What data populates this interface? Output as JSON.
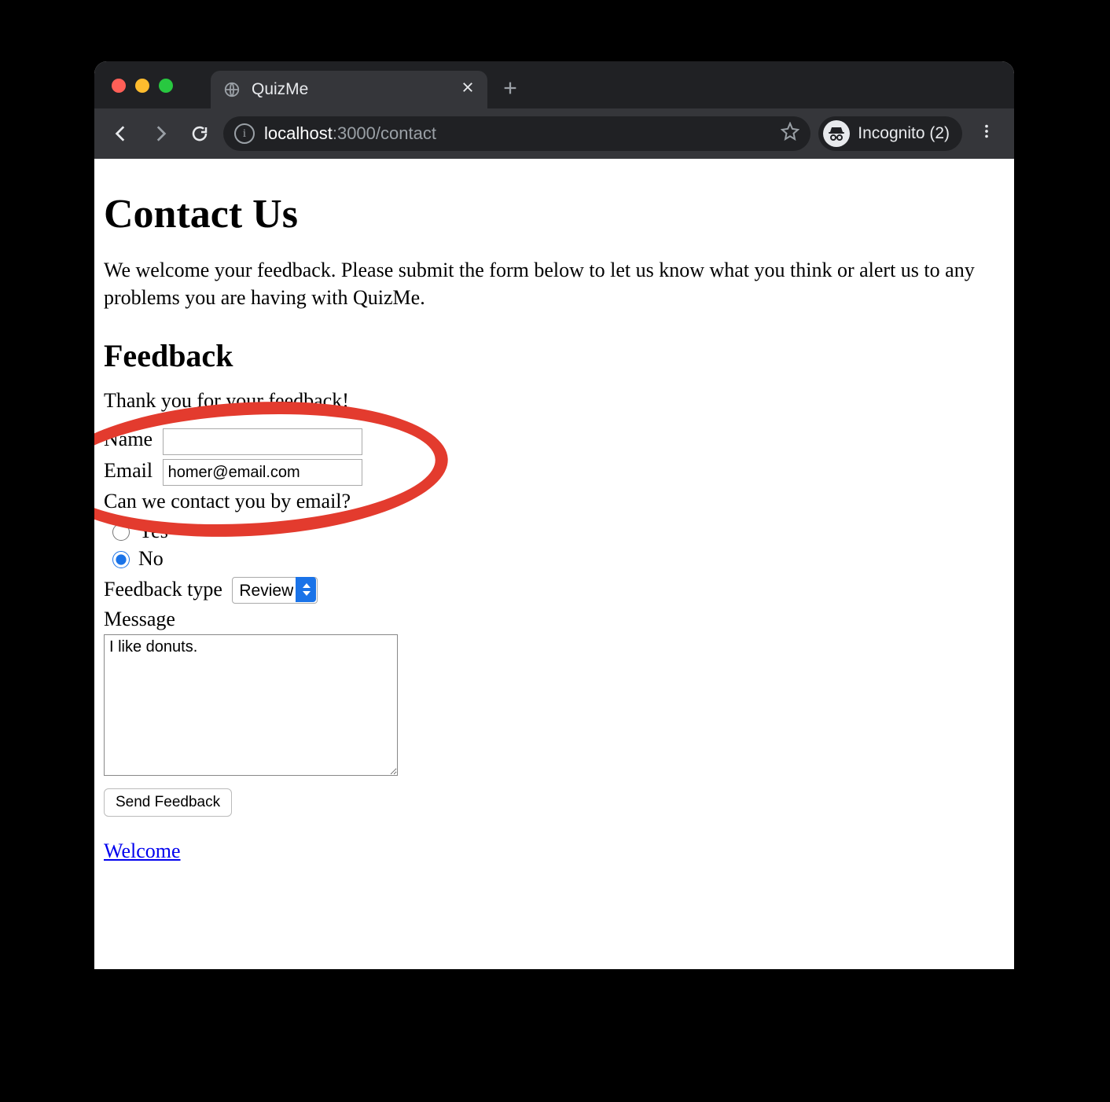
{
  "browser": {
    "tab_title": "QuizMe",
    "url_host": "localhost",
    "url_path": ":3000/contact",
    "incognito_label": "Incognito (2)"
  },
  "page": {
    "h1": "Contact Us",
    "intro": "We welcome your feedback. Please submit the form below to let us know what you think or alert us to any problems you are having with QuizMe.",
    "h2": "Feedback",
    "flash": "Thank you for your feedback!",
    "labels": {
      "name": "Name",
      "email": "Email",
      "contact_q": "Can we contact you by email?",
      "yes": "Yes",
      "no": "No",
      "feedback_type": "Feedback type",
      "message": "Message"
    },
    "values": {
      "name": "",
      "email": "homer@email.com",
      "contact_selected": "no",
      "feedback_type_selected": "Review",
      "message": "I like donuts."
    },
    "feedback_type_options": [
      "Review"
    ],
    "submit_label": "Send Feedback",
    "footer_link": "Welcome"
  }
}
